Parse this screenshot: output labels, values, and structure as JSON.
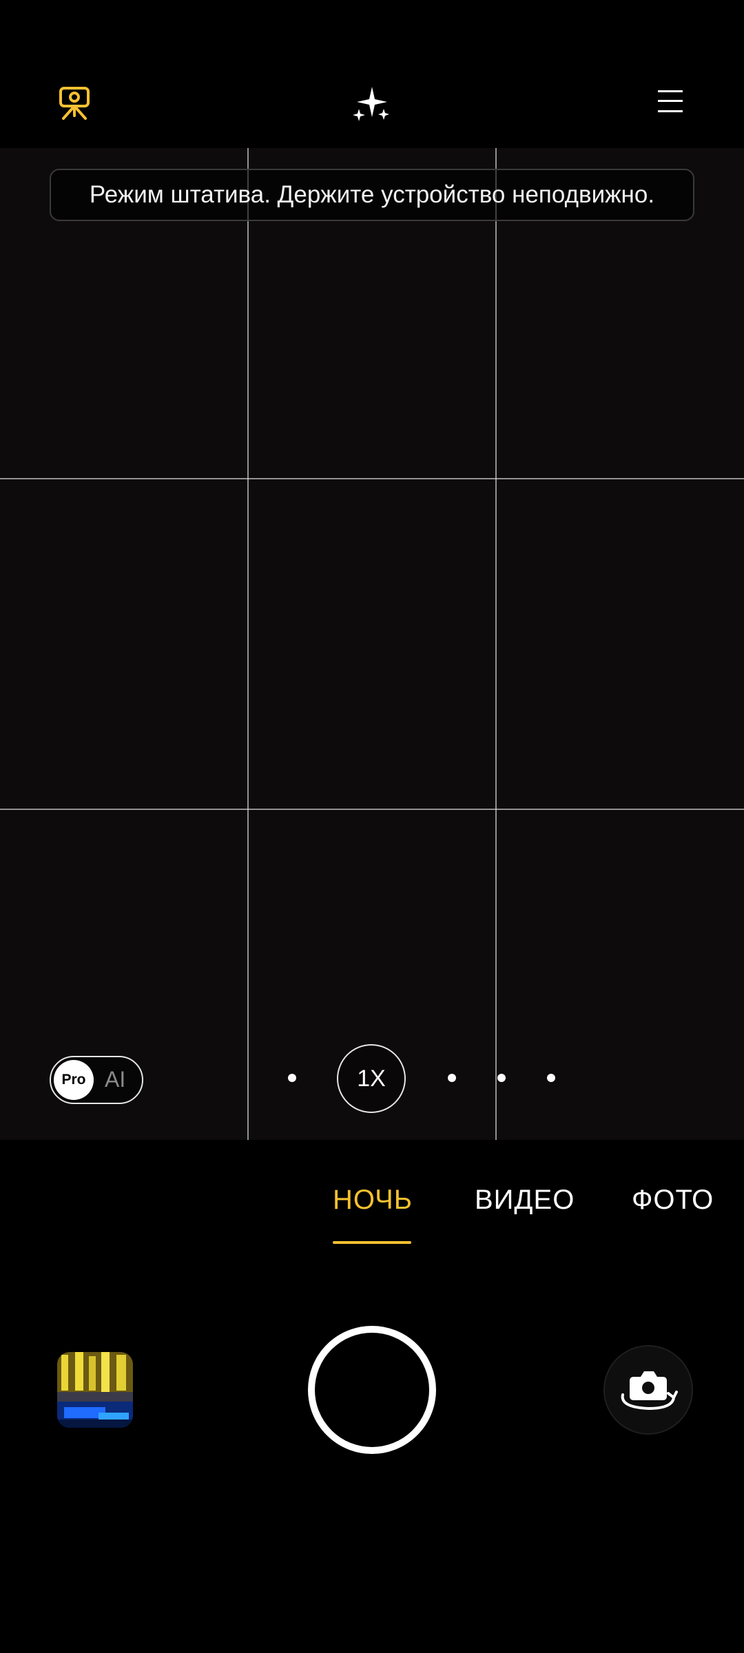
{
  "top_bar": {
    "tripod_icon": "tripod-camera-icon",
    "ai_icon": "sparkles-icon",
    "menu_icon": "menu-icon",
    "accent_color": "#f6c131"
  },
  "viewfinder": {
    "hint": "Режим штатива. Держите устройство неподвижно.",
    "toggle": {
      "left_label": "Pro",
      "right_label": "AI"
    },
    "zoom": {
      "label": "1X"
    }
  },
  "modes": {
    "items": [
      {
        "label": "НОЧЬ",
        "active": true
      },
      {
        "label": "ВИДЕО",
        "active": false
      },
      {
        "label": "ФОТО",
        "active": false
      }
    ]
  },
  "bottom_bar": {
    "gallery_icon": "gallery-thumbnail",
    "shutter_icon": "shutter-button",
    "switch_icon": "switch-camera-icon"
  }
}
